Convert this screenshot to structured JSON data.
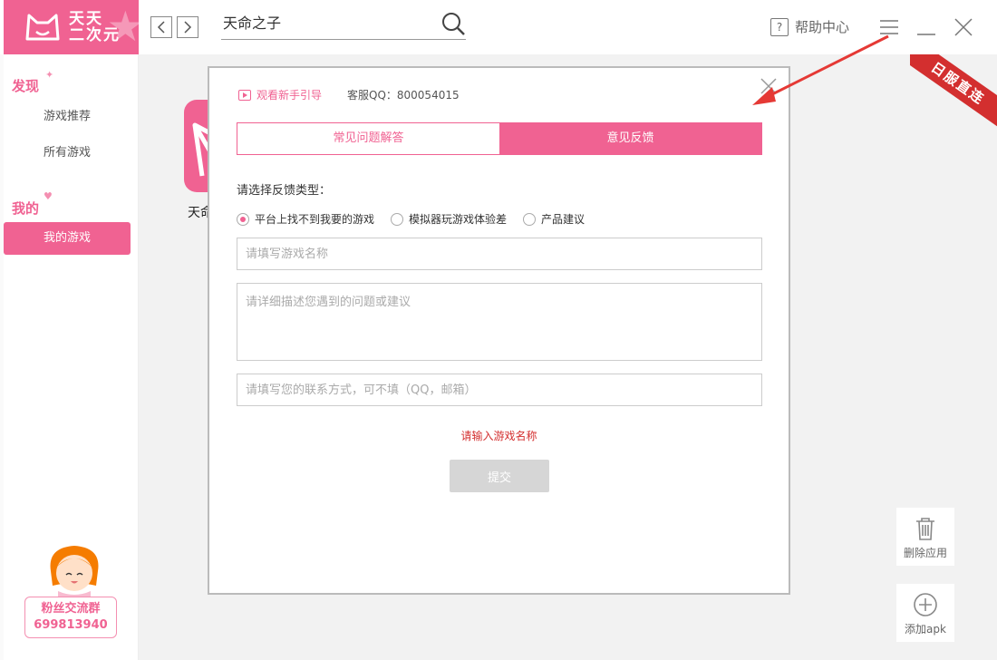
{
  "app": {
    "logo_line1": "天天",
    "logo_line2": "二次元",
    "accent_color": "#f06292"
  },
  "topbar": {
    "back_icon": "chevron-left-icon",
    "forward_icon": "chevron-right-icon",
    "search_value": "天命之子",
    "help_label": "帮助中心"
  },
  "sidebar": {
    "discover_title": "发现",
    "discover_items": [
      "游戏推荐",
      "所有游戏"
    ],
    "mine_title": "我的",
    "mine_items": [
      "我的游戏"
    ],
    "fans_title": "粉丝交流群",
    "fans_number": "699813940"
  },
  "main": {
    "game_name": "天命",
    "ribbon_text": "日服直连",
    "tools": [
      "删除应用",
      "添加apk"
    ]
  },
  "dialog": {
    "guide_label": "观看新手引导",
    "service_qq": "客服QQ：800054015",
    "tabs": [
      "常见问题解答",
      "意见反馈"
    ],
    "active_tab": "意见反馈",
    "type_label": "请选择反馈类型：",
    "radio_options": [
      "平台上找不到我要的游戏",
      "模拟器玩游戏体验差",
      "产品建议"
    ],
    "selected_option": "平台上找不到我要的游戏",
    "game_name_placeholder": "请填写游戏名称",
    "description_placeholder": "请详细描述您遇到的问题或建议",
    "contact_placeholder": "请填写您的联系方式，可不填（QQ，邮箱）",
    "error_text": "请输入游戏名称",
    "submit_label": "提交"
  }
}
